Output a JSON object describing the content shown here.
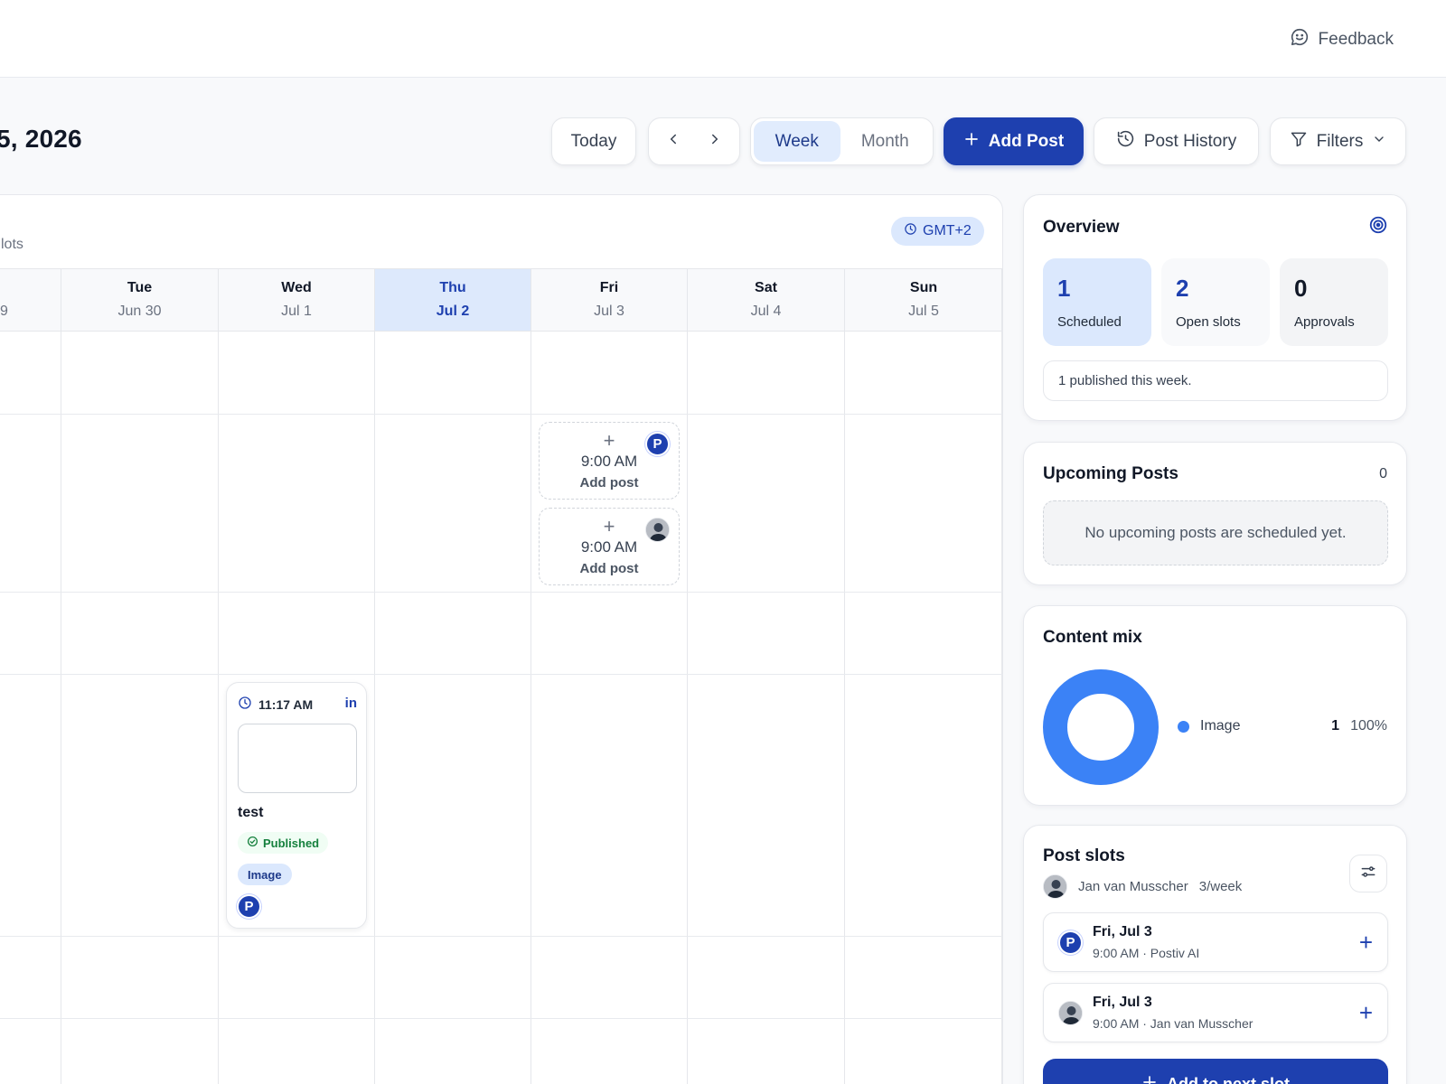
{
  "header": {
    "feedback_label": "Feedback"
  },
  "toolbar": {
    "date_heading": "5, 2026",
    "today_label": "Today",
    "week_label": "Week",
    "month_label": "Month",
    "add_post_label": "Add Post",
    "history_label": "Post History",
    "filters_label": "Filters"
  },
  "calendar": {
    "slots_caption": "lots",
    "timezone": "GMT+2",
    "partial_day_date": "9",
    "days": [
      {
        "name": "Tue",
        "date": "Jun 30"
      },
      {
        "name": "Wed",
        "date": "Jul 1"
      },
      {
        "name": "Thu",
        "date": "Jul 2",
        "today": true
      },
      {
        "name": "Fri",
        "date": "Jul 3"
      },
      {
        "name": "Sat",
        "date": "Jul 4"
      },
      {
        "name": "Sun",
        "date": "Jul 5"
      }
    ],
    "open_slots": [
      {
        "time": "9:00 AM",
        "label": "Add post",
        "avatar": "P"
      },
      {
        "time": "9:00 AM",
        "label": "Add post",
        "avatar": "photo"
      }
    ],
    "post": {
      "time": "11:17 AM",
      "network_icon": "in",
      "title": "test",
      "status": "Published",
      "tag": "Image",
      "avatar": "P"
    }
  },
  "overview": {
    "title": "Overview",
    "stats": [
      {
        "value": "1",
        "label": "Scheduled"
      },
      {
        "value": "2",
        "label": "Open slots"
      },
      {
        "value": "0",
        "label": "Approvals"
      }
    ],
    "summary": "1 published this week."
  },
  "upcoming": {
    "title": "Upcoming Posts",
    "count": "0",
    "empty_text": "No upcoming posts are scheduled yet."
  },
  "content_mix": {
    "title": "Content mix",
    "items": [
      {
        "label": "Image",
        "count": "1",
        "percent": "100%",
        "color": "#3b82f6"
      }
    ]
  },
  "post_slots": {
    "title": "Post slots",
    "user": "Jan van Musscher",
    "frequency": "3/week",
    "items": [
      {
        "day": "Fri, Jul 3",
        "detail": "9:00 AM · Postiv AI",
        "avatar": "P"
      },
      {
        "day": "Fri, Jul 3",
        "detail": "9:00 AM · Jan van Musscher",
        "avatar": "photo"
      }
    ],
    "next_label": "Add to next slot"
  },
  "colors": {
    "primary": "#1e40af",
    "accent_blue": "#3b82f6",
    "today_bg": "#dde9fc",
    "published_green": "#15803d"
  }
}
